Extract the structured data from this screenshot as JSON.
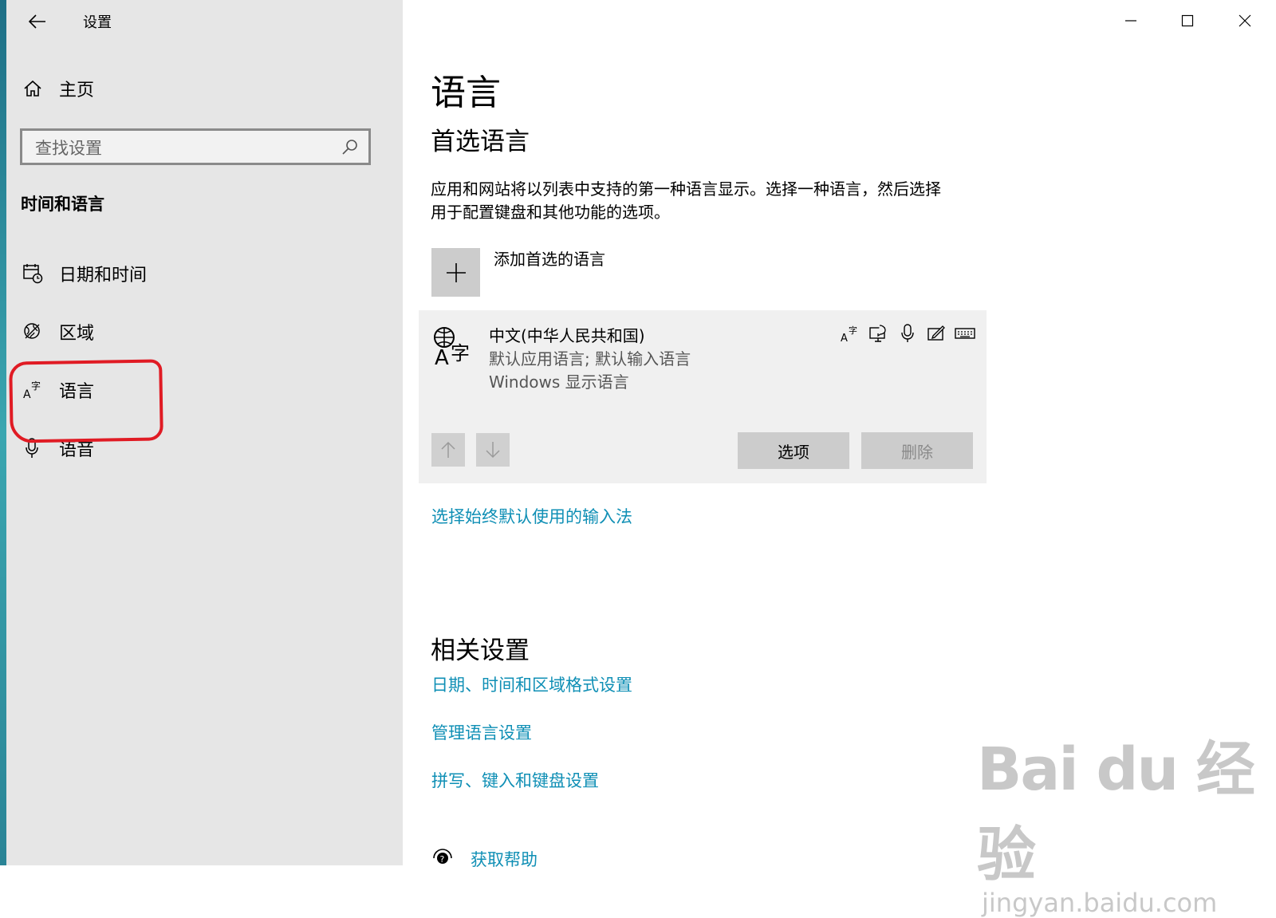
{
  "window": {
    "title": "设置"
  },
  "colors": {
    "accent_link": "#0f8fb5",
    "sidebar_bg": "#e6e6e6",
    "highlight_ring": "#e01b24"
  },
  "sidebar": {
    "home_label": "主页",
    "search_placeholder": "查找设置",
    "section_title": "时间和语言",
    "items": [
      {
        "label": "日期和时间",
        "icon": "calendar-clock-icon"
      },
      {
        "label": "区域",
        "icon": "globe-icon"
      },
      {
        "label": "语言",
        "icon": "language-icon",
        "selected": true
      },
      {
        "label": "语音",
        "icon": "microphone-icon"
      }
    ]
  },
  "main": {
    "title": "语言",
    "preferred_title": "首选语言",
    "description_line1": "应用和网站将以列表中支持的第一种语言显示。选择一种语言，然后选择",
    "description_line2": "用于配置键盘和其他功能的选项。",
    "add_language_label": "添加首选的语言",
    "language": {
      "name": "中文(中华人民共和国)",
      "subtitle1": "默认应用语言; 默认输入语言",
      "subtitle2": "Windows 显示语言",
      "feature_icons": [
        "language-pack-icon",
        "text-to-speech-icon",
        "speech-icon",
        "handwriting-icon",
        "keyboard-icon"
      ]
    },
    "options_label": "选项",
    "remove_label": "删除",
    "default_input_link": "选择始终默认使用的输入法",
    "related_title": "相关设置",
    "related_links": [
      "日期、时间和区域格式设置",
      "管理语言设置",
      "拼写、键入和键盘设置"
    ],
    "help_link": "获取帮助"
  },
  "watermark": {
    "brand": "Bai du 经验",
    "url": "jingyan.baidu.com"
  }
}
